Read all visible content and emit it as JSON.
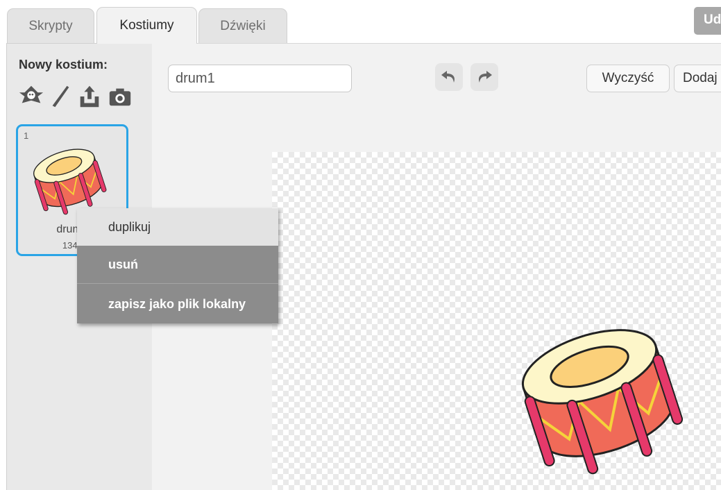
{
  "tabs": [
    {
      "label": "Skrypty",
      "active": false
    },
    {
      "label": "Kostiumy",
      "active": true
    },
    {
      "label": "Dźwięki",
      "active": false
    }
  ],
  "top_right_button": {
    "label": "Ud"
  },
  "left_panel": {
    "new_costume_label": "Nowy kostium:",
    "tools": [
      {
        "icon": "sprite-library-icon"
      },
      {
        "icon": "paint-brush-icon"
      },
      {
        "icon": "upload-icon"
      },
      {
        "icon": "camera-icon"
      }
    ],
    "costume": {
      "index": "1",
      "name": "drum1",
      "size": "134x"
    }
  },
  "editor": {
    "costume_name_value": "drum1",
    "undo_icon": "undo-icon",
    "redo_icon": "redo-icon",
    "clear_label": "Wyczyść",
    "add_label": "Dodaj"
  },
  "context_menu": {
    "items": [
      "duplikuj",
      "usuń",
      "zapisz jako plik lokalny"
    ],
    "highlighted": "usuń"
  },
  "colors": {
    "selection_border": "#2aa4e6",
    "menu_bg": "#8c8c8c",
    "drum_body": "#f06a58",
    "drum_top": "#fdf6c9",
    "drum_inner": "#fbd07a",
    "drum_strap": "#e6396a"
  }
}
